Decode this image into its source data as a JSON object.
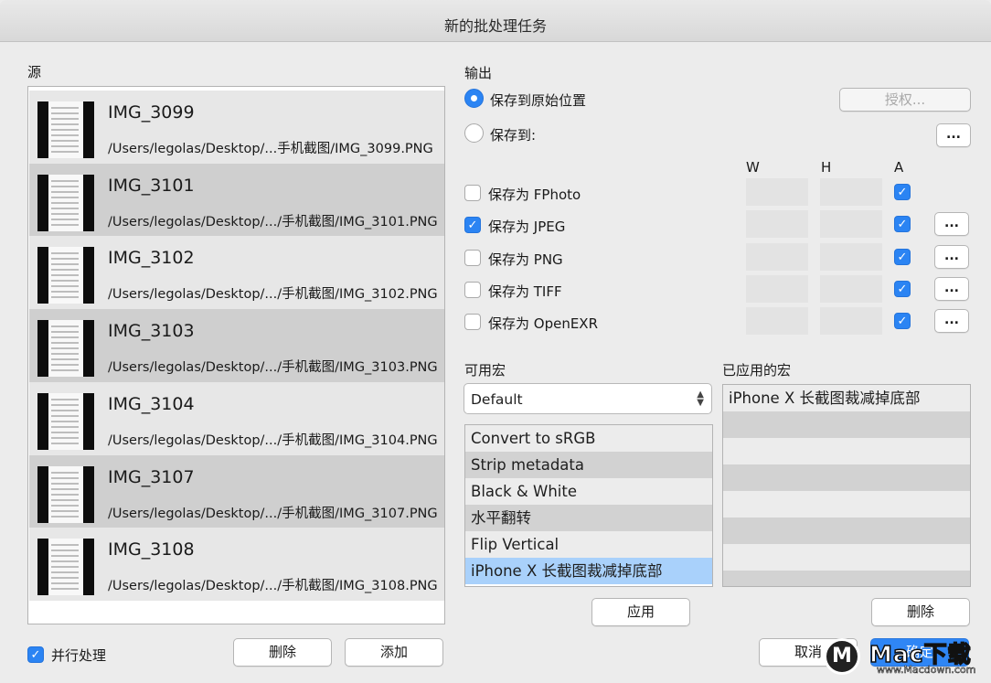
{
  "window": {
    "title": "新的批处理任务"
  },
  "source": {
    "label": "源",
    "items": [
      {
        "name": "IMG_3099",
        "path": "/Users/legolas/Desktop/...手机截图/IMG_3099.PNG"
      },
      {
        "name": "IMG_3101",
        "path": "/Users/legolas/Desktop/.../手机截图/IMG_3101.PNG"
      },
      {
        "name": "IMG_3102",
        "path": "/Users/legolas/Desktop/.../手机截图/IMG_3102.PNG"
      },
      {
        "name": "IMG_3103",
        "path": "/Users/legolas/Desktop/.../手机截图/IMG_3103.PNG"
      },
      {
        "name": "IMG_3104",
        "path": "/Users/legolas/Desktop/.../手机截图/IMG_3104.PNG"
      },
      {
        "name": "IMG_3107",
        "path": "/Users/legolas/Desktop/.../手机截图/IMG_3107.PNG"
      },
      {
        "name": "IMG_3108",
        "path": "/Users/legolas/Desktop/.../手机截图/IMG_3108.PNG"
      }
    ],
    "parallel_label": "并行处理",
    "parallel_checked": true,
    "delete_label": "删除",
    "add_label": "添加"
  },
  "output": {
    "label": "输出",
    "save_original_label": "保存到原始位置",
    "save_original_selected": true,
    "authorize_label": "授权...",
    "save_to_label": "保存到:",
    "browse_label": "...",
    "col_w": "W",
    "col_h": "H",
    "col_a": "A",
    "formats": [
      {
        "label": "保存为 FPhoto",
        "checked": false,
        "a_checked": true,
        "has_options": false
      },
      {
        "label": "保存为 JPEG",
        "checked": true,
        "a_checked": true,
        "has_options": true
      },
      {
        "label": "保存为 PNG",
        "checked": false,
        "a_checked": true,
        "has_options": true
      },
      {
        "label": "保存为 TIFF",
        "checked": false,
        "a_checked": true,
        "has_options": true
      },
      {
        "label": "保存为 OpenEXR",
        "checked": false,
        "a_checked": true,
        "has_options": true
      }
    ],
    "options_label": "..."
  },
  "macros": {
    "available_label": "可用宏",
    "set_value": "Default",
    "available": [
      "Convert to sRGB",
      "Strip metadata",
      "Black & White",
      "水平翻转",
      "Flip Vertical",
      "iPhone X 长截图裁减掉底部"
    ],
    "selected_index": 5,
    "apply_label": "应用",
    "applied_label": "已应用的宏",
    "applied": [
      "iPhone X 长截图裁减掉底部"
    ],
    "remove_label": "删除"
  },
  "footer": {
    "cancel_label": "取消",
    "ok_label": "确定"
  },
  "watermark": {
    "brand": "Mac下载",
    "url": "www.Macdown.com",
    "logo": "M"
  },
  "colors": {
    "accent": "#2b84f3",
    "selection": "#a9d1fb"
  }
}
